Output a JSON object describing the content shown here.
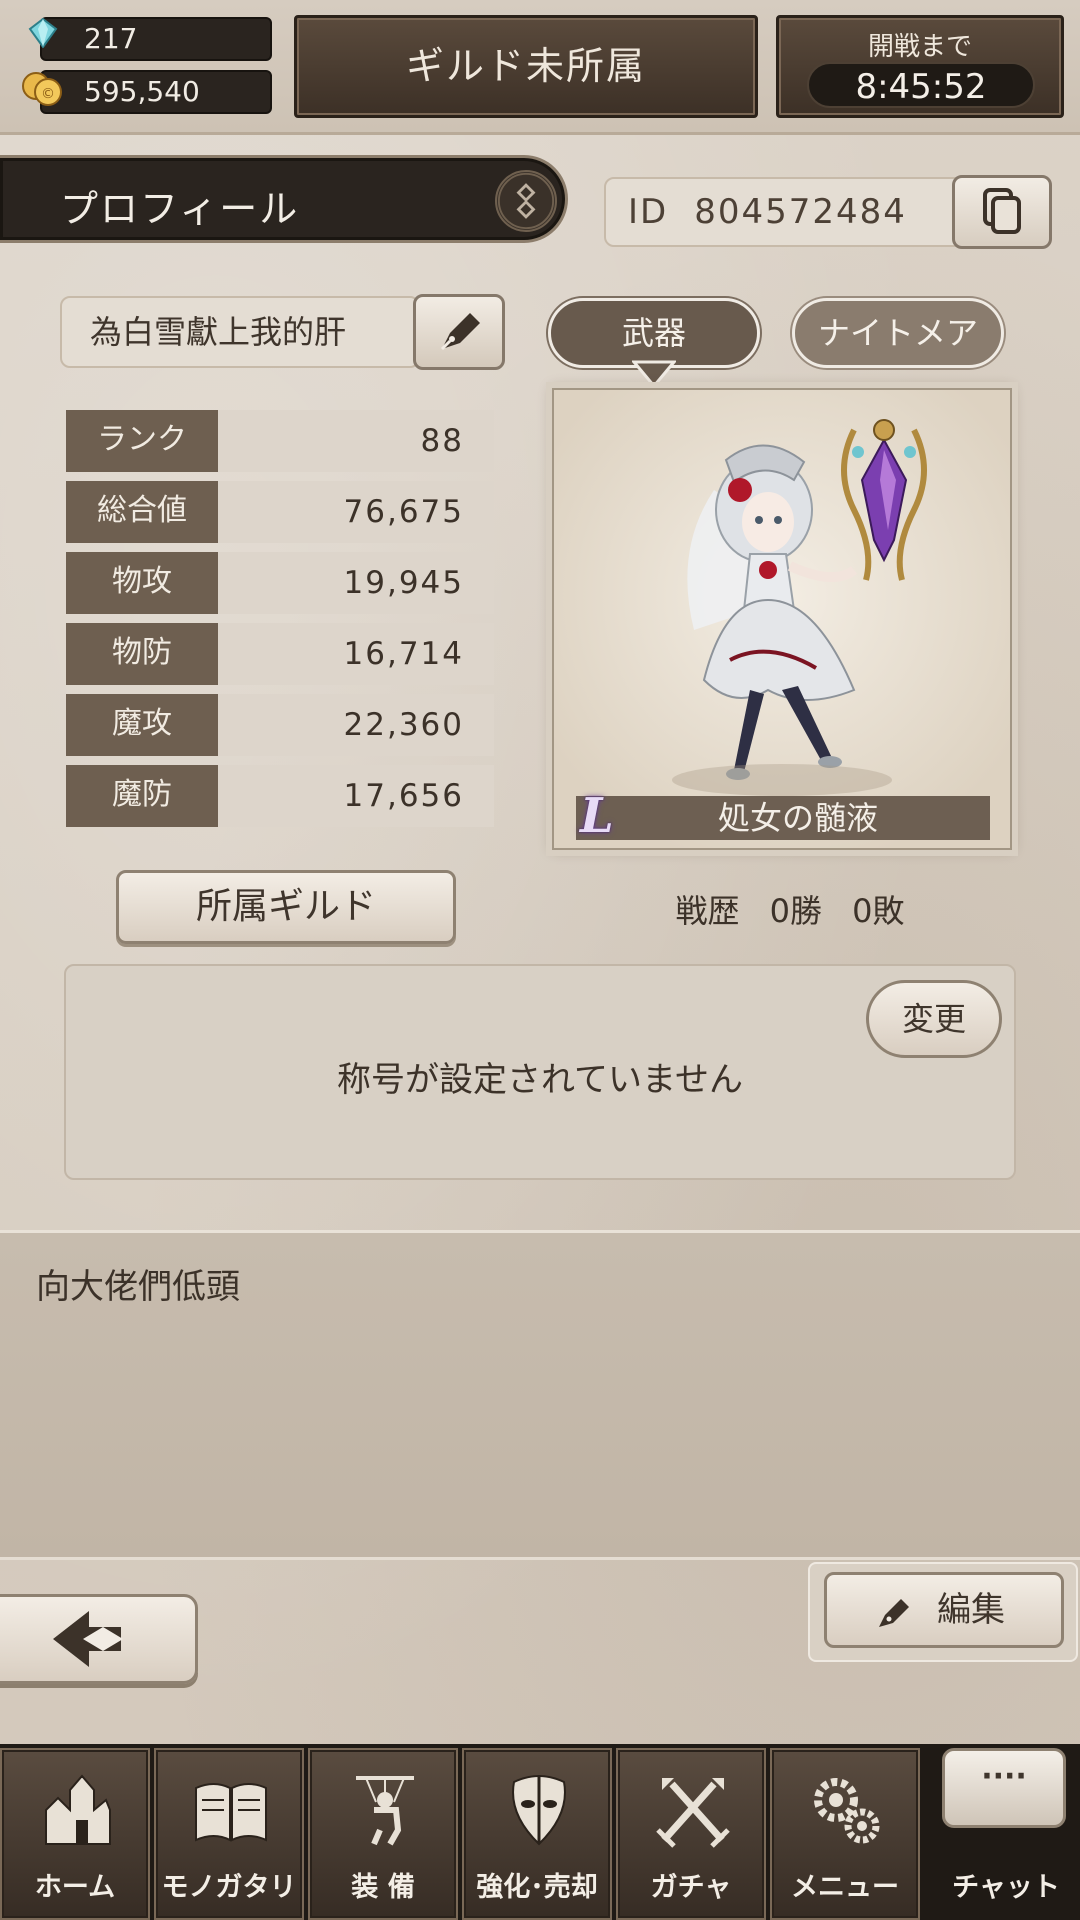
{
  "currency": {
    "gems": "217",
    "coins": "595,540"
  },
  "guild_status": "ギルド未所属",
  "battle": {
    "label": "開戦まで",
    "timer": "8:45:52"
  },
  "profile": {
    "title": "プロフィール",
    "id_label": "ID",
    "id_value": "804572484",
    "name": "為白雪獻上我的肝"
  },
  "stats": [
    {
      "label": "ランク",
      "value": "88"
    },
    {
      "label": "総合値",
      "value": "76,675"
    },
    {
      "label": "物攻",
      "value": "19,945"
    },
    {
      "label": "物防",
      "value": "16,714"
    },
    {
      "label": "魔攻",
      "value": "22,360"
    },
    {
      "label": "魔防",
      "value": "17,656"
    }
  ],
  "tabs": {
    "weapon": "武器",
    "nightmare": "ナイトメア"
  },
  "weapon": {
    "rarity": "L",
    "name": "処女の髄液"
  },
  "guild_button": "所属ギルド",
  "record": {
    "label": "戦歴",
    "wins": "0勝",
    "losses": "0敗"
  },
  "title_box": {
    "text": "称号が設定されていません",
    "change_button": "変更"
  },
  "comment": "向大佬們低頭",
  "edit_button": "編集",
  "nav": [
    {
      "label": "ホーム",
      "icon": "home-icon"
    },
    {
      "label": "モノガタリ",
      "icon": "book-icon"
    },
    {
      "label": "装 備",
      "icon": "puppet-icon"
    },
    {
      "label": "強化･売却",
      "icon": "mask-icon"
    },
    {
      "label": "ガチャ",
      "icon": "swords-icon"
    },
    {
      "label": "メニュー",
      "icon": "gears-icon"
    }
  ],
  "chat": {
    "bubble": "····",
    "label": "チャット"
  },
  "colors": {
    "panel_dark": "#2a241f",
    "stat_label_bg": "#6e5f50",
    "parchment": "#d9cfc3",
    "rarity_glow": "#6c3fa0"
  }
}
